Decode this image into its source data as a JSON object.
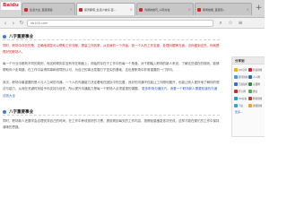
{
  "browser": {
    "brand": "Baidu",
    "tabs": [
      {
        "label": "生活大全_百度经验"
      },
      {
        "label": "思普斯塔_生活小常识-百..."
      },
      {
        "label": "沟通的技巧_人际交往"
      },
      {
        "label": "职场技能_百度知..."
      }
    ],
    "new_tab": "+",
    "url": "lib100.com",
    "nav": {
      "back": "‹",
      "forward": "›",
      "refresh": "↻",
      "search": "⌕",
      "bookmark": "☆",
      "menu": "≡"
    }
  },
  "article": {
    "section1_title": "八字重要事业",
    "highlight": "同时，职场中存在的是，正确地调控可以帮助工作流程，提高工作效率，从自身的一个开始，到一个人的工作态度，处理问题等方面，当你做到这些，你就是很好的职场人。",
    "para1": "每一个行业中都有不同的规则，而这种规则并没有写在明面上，却始终存在于工作中的每一个角落。对于刚踏入职场的新人来说，了解这些潜在的规则，能够帮助你少走弯路，在工作中赢得同事和领导的认可，为自己的事业发展打下坚实的基础，这也是职场中非常重要的一门学问。",
    "para2": "其次，职场中最重要的是人与人之间的沟通，一个人的沟通能力决定着他在团队中的位置，良好的沟通不仅能让工作顺利展开，也能让别人更好地了解你的想法与能力，从而在关键时刻给予你支持与信任，所以提升沟通能力是每一个职场人必须重视的课题。",
    "link": "更多职场沟通技巧，请看一个职场新人需要知道的沟通法则大全",
    "section2_title": "八字重要事业",
    "para3": "同时，职场新人还要学会合理安排自己的时间，在工作中养成良好的习惯，提前规划每天的工作内容，按照轻重缓急依次完成，这样才能在繁忙的工作中保持清晰的思路。"
  },
  "share": {
    "title": "分享到",
    "items": [
      {
        "label": "QQ空间",
        "color": "#f5b400"
      },
      {
        "label": "新浪微博",
        "color": "#e6162d"
      },
      {
        "label": "腾讯微博",
        "color": "#3f9ee3"
      },
      {
        "label": "人人网",
        "color": "#1d6fb8"
      },
      {
        "label": "百度贴吧",
        "color": "#3a6bd5"
      },
      {
        "label": "豆瓣网",
        "color": "#2c8a3a"
      },
      {
        "label": "开心网",
        "color": "#d8232a"
      },
      {
        "label": "微信",
        "color": "#44b549"
      },
      {
        "label": "QQ好友",
        "color": "#1aa1e5"
      },
      {
        "label": "网易微博",
        "color": "#c43a2f"
      },
      {
        "label": "飞信",
        "color": "#2aa6d6"
      },
      {
        "label": "搜狐微博",
        "color": "#f2a41b"
      }
    ],
    "more": "更多..."
  }
}
